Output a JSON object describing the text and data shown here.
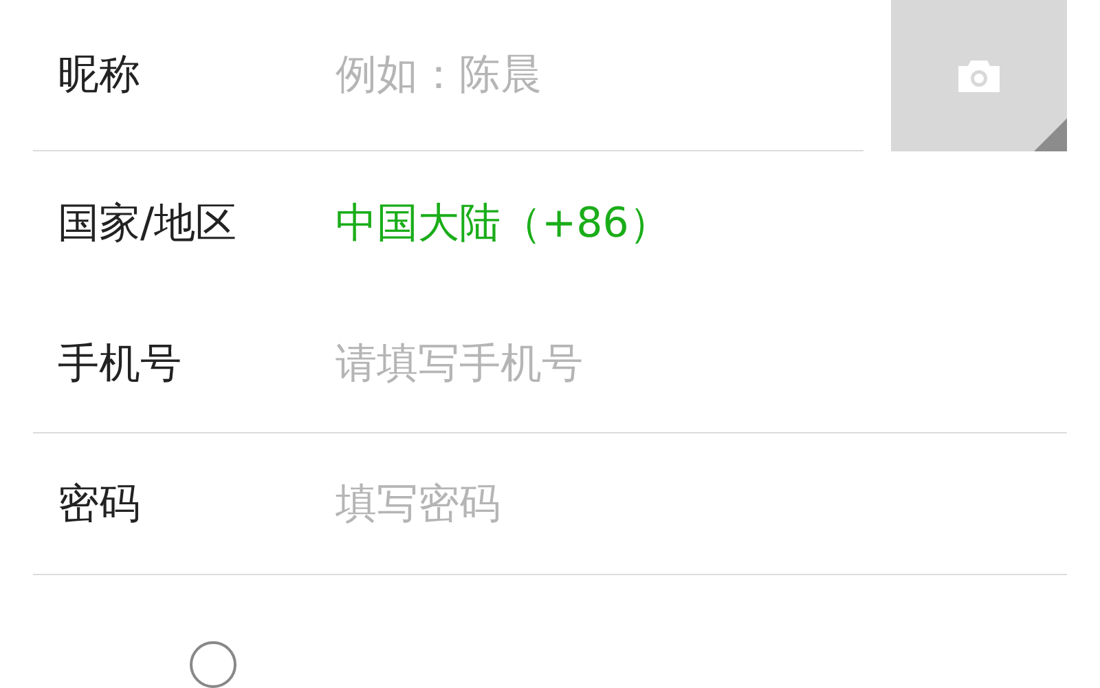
{
  "fields": [
    {
      "kind": "input",
      "label": "昵称",
      "placeholder": "例如：陈晨",
      "divider": true
    },
    {
      "kind": "select",
      "label": "国家/地区",
      "value": "中国大陆（+86）",
      "divider": false
    },
    {
      "kind": "input",
      "label": "手机号",
      "placeholder": "请填写手机号",
      "divider": true
    },
    {
      "kind": "input",
      "label": "密码",
      "placeholder": "填写密码",
      "divider": true
    }
  ],
  "agreement": {
    "checked": false
  }
}
